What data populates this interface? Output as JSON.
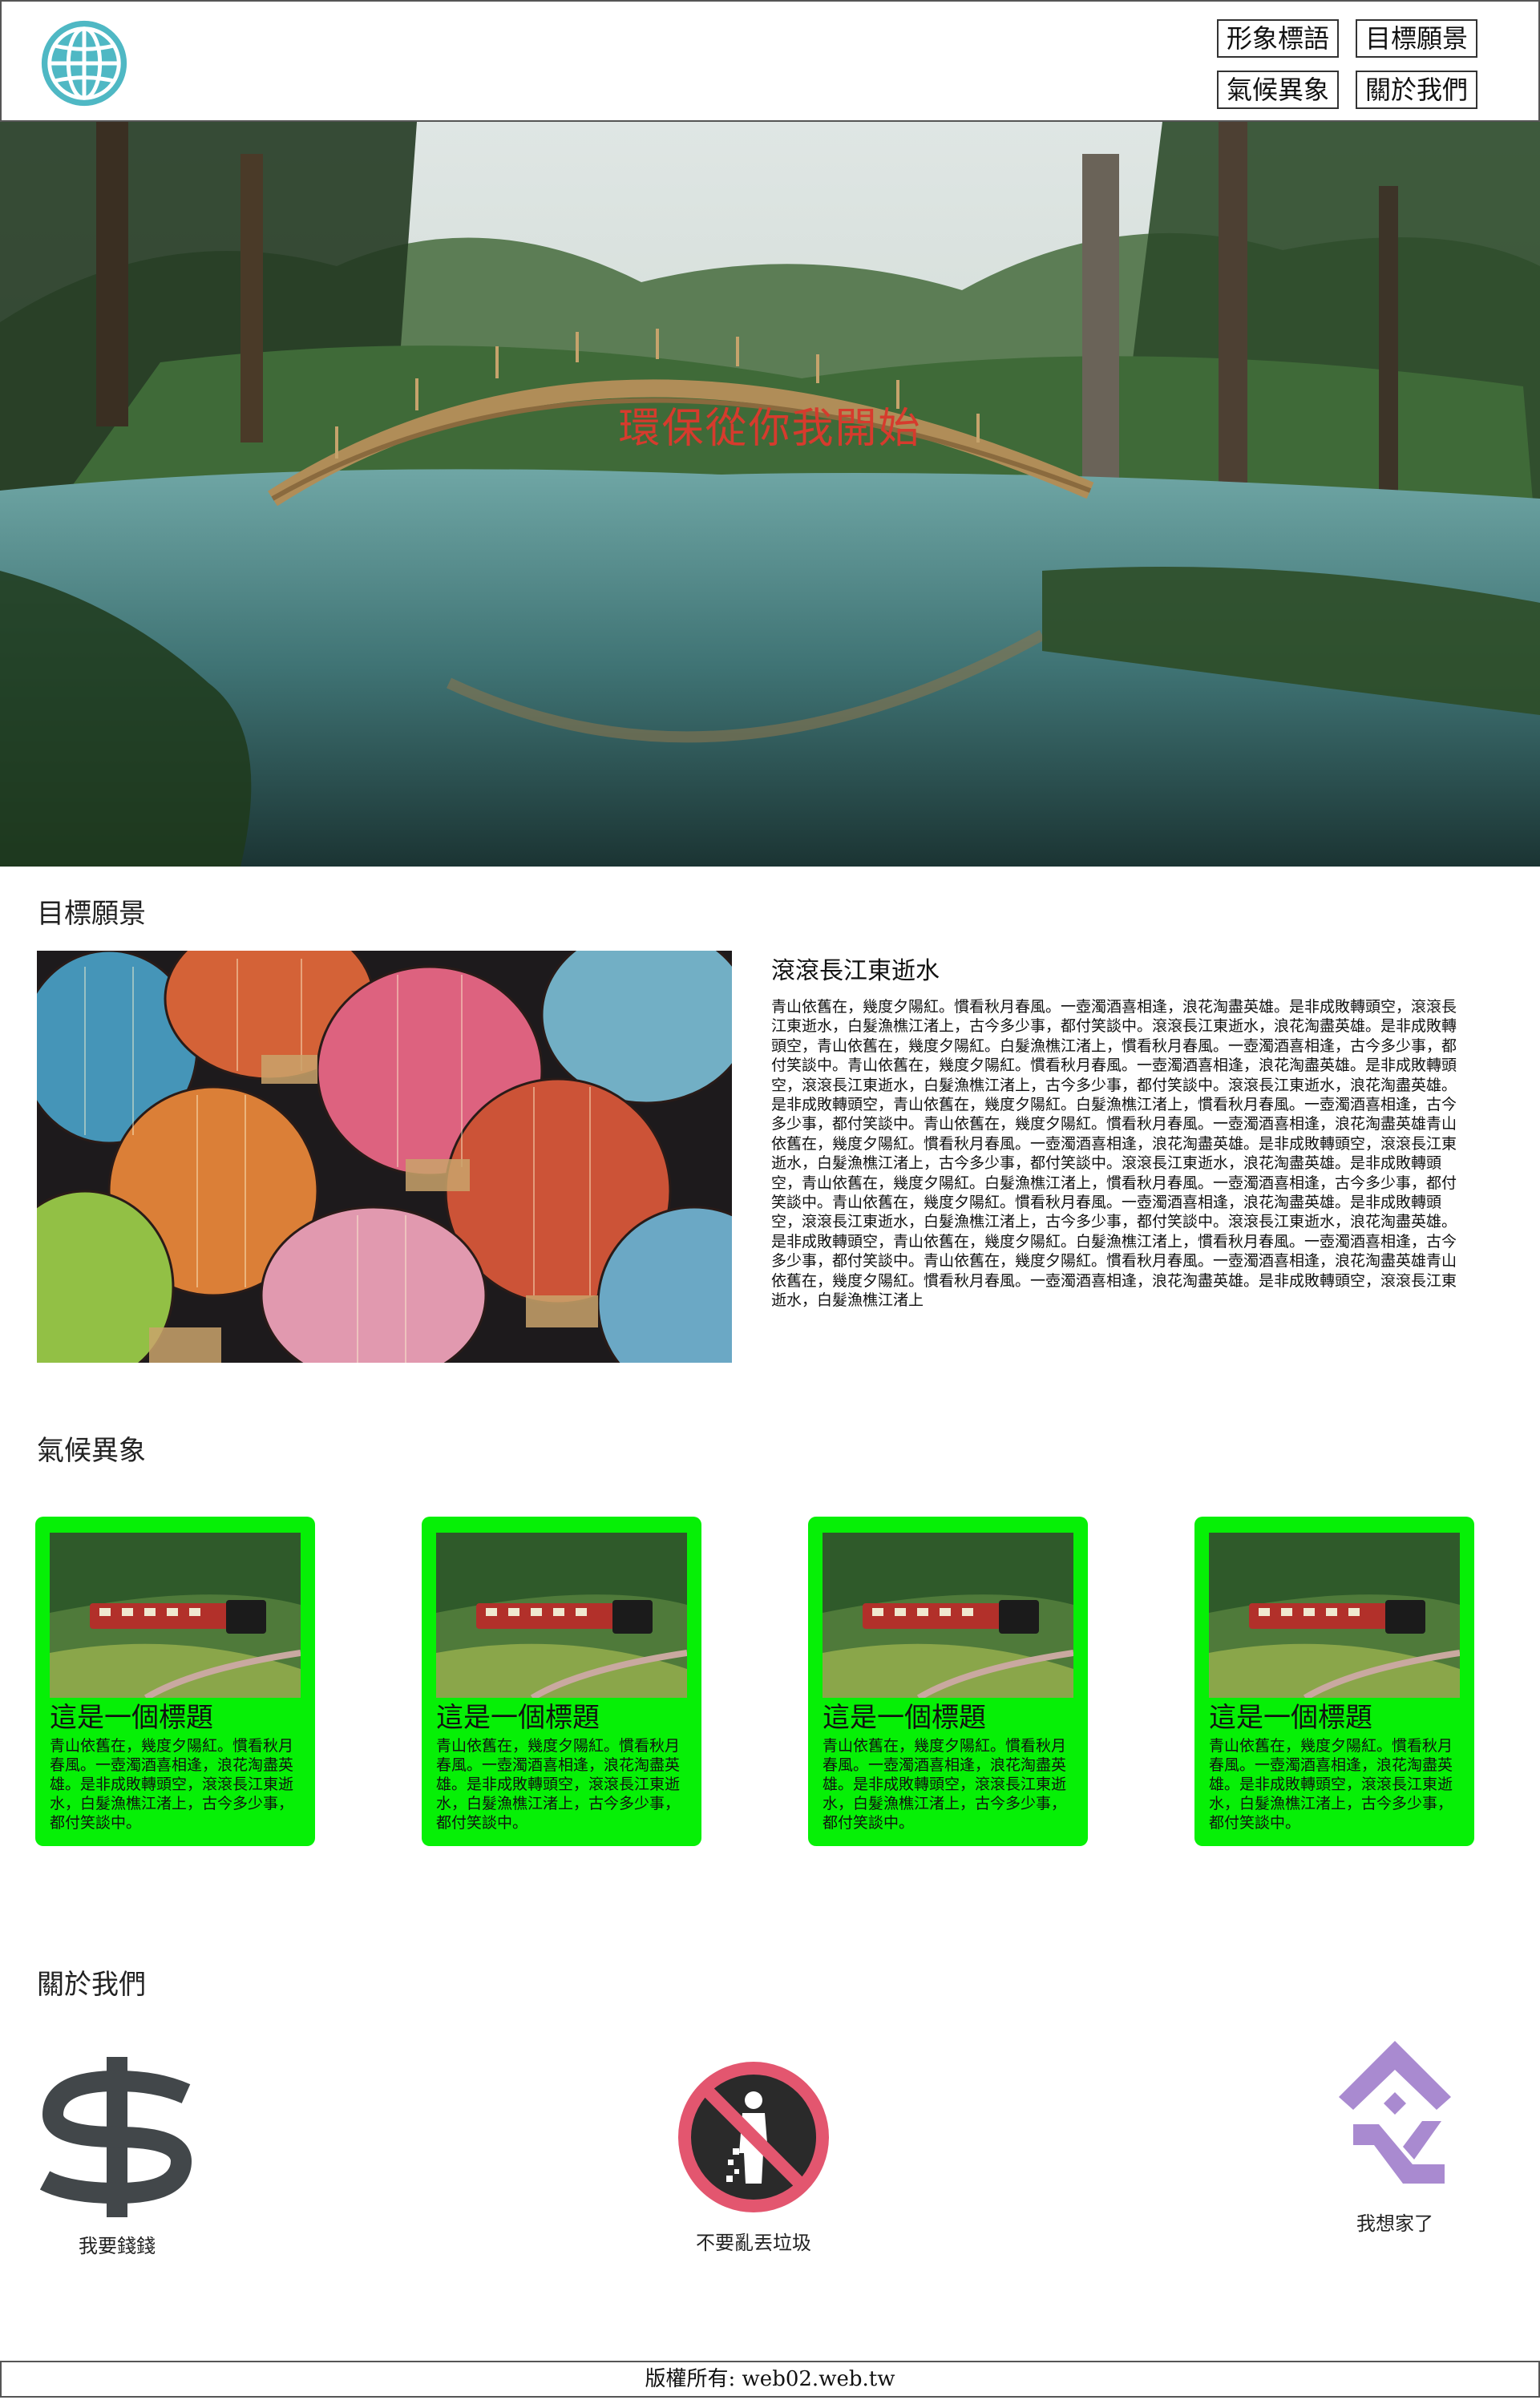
{
  "nav": {
    "items": [
      "形象標語",
      "目標願景",
      "氣候異象",
      "關於我們"
    ]
  },
  "hero": {
    "slogan": "環保從你我開始"
  },
  "goals": {
    "title": "目標願景",
    "subtitle": "滾滾長江東逝水",
    "body": "青山依舊在，幾度夕陽紅。慣看秋月春風。一壺濁酒喜相逢，浪花淘盡英雄。是非成敗轉頭空，滾滾長江東逝水，白髮漁樵江渚上，古今多少事，都付笑談中。滾滾長江東逝水，浪花淘盡英雄。是非成敗轉頭空，青山依舊在，幾度夕陽紅。白髮漁樵江渚上，慣看秋月春風。一壺濁酒喜相逢，古今多少事，都付笑談中。青山依舊在，幾度夕陽紅。慣看秋月春風。一壺濁酒喜相逢，浪花淘盡英雄。是非成敗轉頭空，滾滾長江東逝水，白髮漁樵江渚上，古今多少事，都付笑談中。滾滾長江東逝水，浪花淘盡英雄。是非成敗轉頭空，青山依舊在，幾度夕陽紅。白髮漁樵江渚上，慣看秋月春風。一壺濁酒喜相逢，古今多少事，都付笑談中。青山依舊在，幾度夕陽紅。慣看秋月春風。一壺濁酒喜相逢，浪花淘盡英雄青山依舊在，幾度夕陽紅。慣看秋月春風。一壺濁酒喜相逢，浪花淘盡英雄。是非成敗轉頭空，滾滾長江東逝水，白髮漁樵江渚上，古今多少事，都付笑談中。滾滾長江東逝水，浪花淘盡英雄。是非成敗轉頭空，青山依舊在，幾度夕陽紅。白髮漁樵江渚上，慣看秋月春風。一壺濁酒喜相逢，古今多少事，都付笑談中。青山依舊在，幾度夕陽紅。慣看秋月春風。一壺濁酒喜相逢，浪花淘盡英雄。是非成敗轉頭空，滾滾長江東逝水，白髮漁樵江渚上，古今多少事，都付笑談中。滾滾長江東逝水，浪花淘盡英雄。是非成敗轉頭空，青山依舊在，幾度夕陽紅。白髮漁樵江渚上，慣看秋月春風。一壺濁酒喜相逢，古今多少事，都付笑談中。青山依舊在，幾度夕陽紅。慣看秋月春風。一壺濁酒喜相逢，浪花淘盡英雄青山依舊在，幾度夕陽紅。慣看秋月春風。一壺濁酒喜相逢，浪花淘盡英雄。是非成敗轉頭空，滾滾長江東逝水，白髮漁樵江渚上"
  },
  "climate": {
    "title": "氣候異象",
    "cards": [
      {
        "title": "這是一個標題",
        "body": "青山依舊在，幾度夕陽紅。慣看秋月春風。一壺濁酒喜相逢，浪花淘盡英雄。是非成敗轉頭空，滾滾長江東逝水，白髮漁樵江渚上，古今多少事，都付笑談中。"
      },
      {
        "title": "這是一個標題",
        "body": "青山依舊在，幾度夕陽紅。慣看秋月春風。一壺濁酒喜相逢，浪花淘盡英雄。是非成敗轉頭空，滾滾長江東逝水，白髮漁樵江渚上，古今多少事，都付笑談中。"
      },
      {
        "title": "這是一個標題",
        "body": "青山依舊在，幾度夕陽紅。慣看秋月春風。一壺濁酒喜相逢，浪花淘盡英雄。是非成敗轉頭空，滾滾長江東逝水，白髮漁樵江渚上，古今多少事，都付笑談中。"
      },
      {
        "title": "這是一個標題",
        "body": "青山依舊在，幾度夕陽紅。慣看秋月春風。一壺濁酒喜相逢，浪花淘盡英雄。是非成敗轉頭空，滾滾長江東逝水，白髮漁樵江渚上，古今多少事，都付笑談中。"
      }
    ]
  },
  "about": {
    "title": "關於我們",
    "items": [
      {
        "icon": "dollar-icon",
        "label": "我要錢錢"
      },
      {
        "icon": "no-littering-icon",
        "label": "不要亂丟垃圾"
      },
      {
        "icon": "homesick-icon",
        "label": "我想家了"
      }
    ]
  },
  "footer": {
    "copyright": "版權所有: web02.web.tw"
  },
  "colors": {
    "card_bg": "#06f006",
    "slogan": "#d63b2d",
    "logo": "#4fb8c4",
    "no_litter_ring": "#e3566f",
    "homesick": "#a98ad0",
    "dollar": "#42474a"
  }
}
